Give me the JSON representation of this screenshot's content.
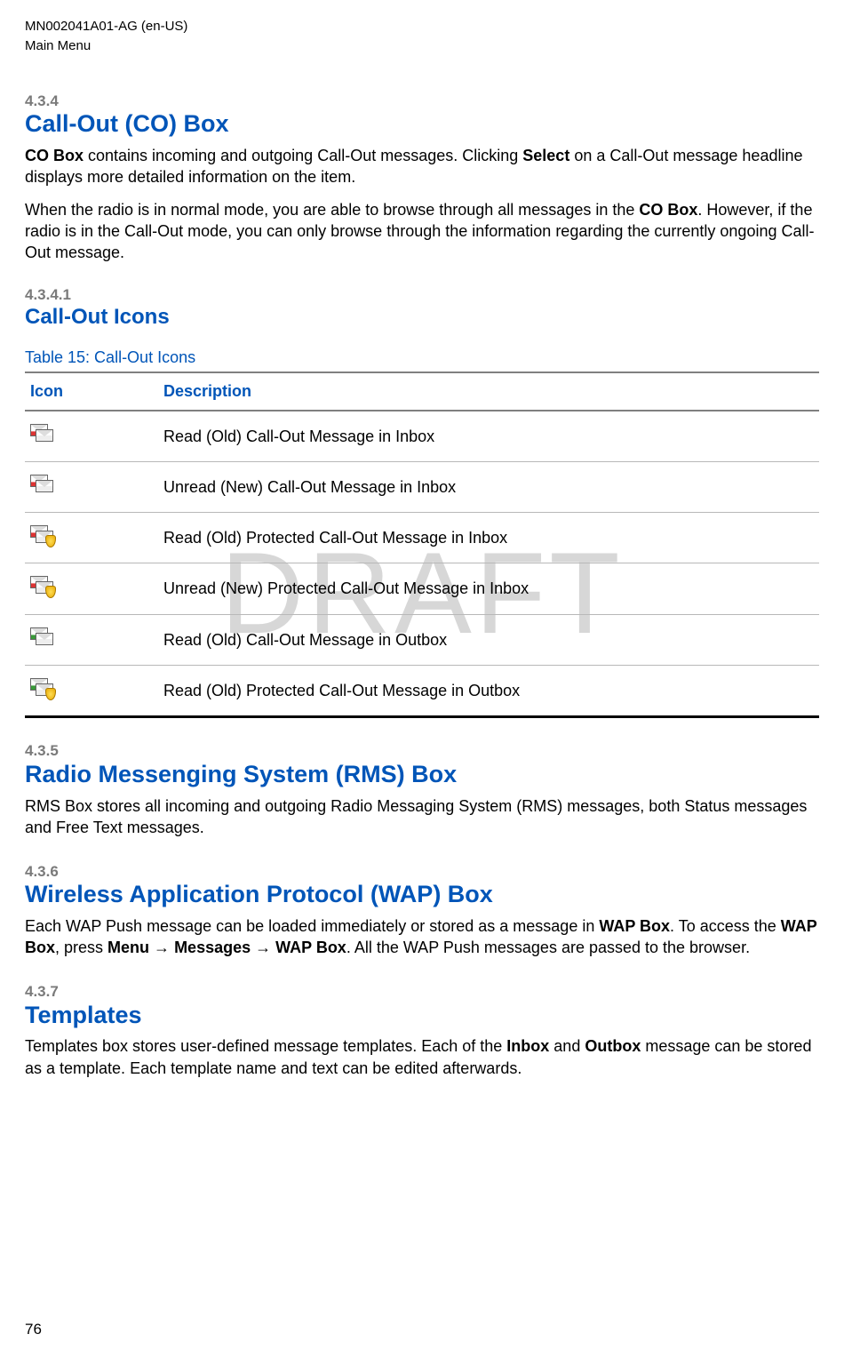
{
  "header": {
    "doc_id": "MN002041A01-AG (en-US)",
    "section": "Main Menu"
  },
  "watermark": "DRAFT",
  "s434": {
    "num": "4.3.4",
    "title": "Call-Out (CO) Box",
    "p1a": "CO Box",
    "p1b": " contains incoming and outgoing Call-Out messages. Clicking ",
    "p1c": "Select",
    "p1d": " on a Call-Out message headline displays more detailed information on the item.",
    "p2a": "When the radio is in normal mode, you are able to browse through all messages in the ",
    "p2b": "CO Box",
    "p2c": ". However, if the radio is in the Call-Out mode, you can only browse through the information regarding the currently ongoing Call-Out message."
  },
  "s4341": {
    "num": "4.3.4.1",
    "title": "Call-Out Icons"
  },
  "table": {
    "caption": "Table 15: Call-Out Icons",
    "col_icon": "Icon",
    "col_desc": "Description",
    "rows": [
      {
        "desc": "Read (Old) Call-Out Message in Inbox"
      },
      {
        "desc": "Unread (New) Call-Out Message in Inbox"
      },
      {
        "desc": "Read (Old) Protected Call-Out Message in Inbox"
      },
      {
        "desc": "Unread (New) Protected Call-Out Message in Inbox"
      },
      {
        "desc": "Read (Old) Call-Out Message in Outbox"
      },
      {
        "desc": "Read (Old) Protected Call-Out Message in Outbox"
      }
    ]
  },
  "s435": {
    "num": "4.3.5",
    "title": "Radio Messenging System (RMS) Box",
    "p1": "RMS Box stores all incoming and outgoing Radio Messaging System (RMS) messages, both Status messages and Free Text messages."
  },
  "s436": {
    "num": "4.3.6",
    "title": "Wireless Application Protocol (WAP) Box",
    "p1a": "Each WAP Push message can be loaded immediately or stored as a message in ",
    "p1b": "WAP Box",
    "p1c": ". To access the ",
    "p1d": "WAP Box",
    "p1e": ", press ",
    "p1f": "Menu",
    "p1g": " → ",
    "p1h": "Messages",
    "p1i": " → ",
    "p1j": "WAP Box",
    "p1k": ". All the WAP Push messages are passed to the browser."
  },
  "s437": {
    "num": "4.3.7",
    "title": "Templates",
    "p1a": "Templates box stores user-defined message templates. Each of the ",
    "p1b": "Inbox",
    "p1c": " and ",
    "p1d": "Outbox",
    "p1e": " message can be stored as a template. Each template name and text can be edited afterwards."
  },
  "page_number": "76"
}
